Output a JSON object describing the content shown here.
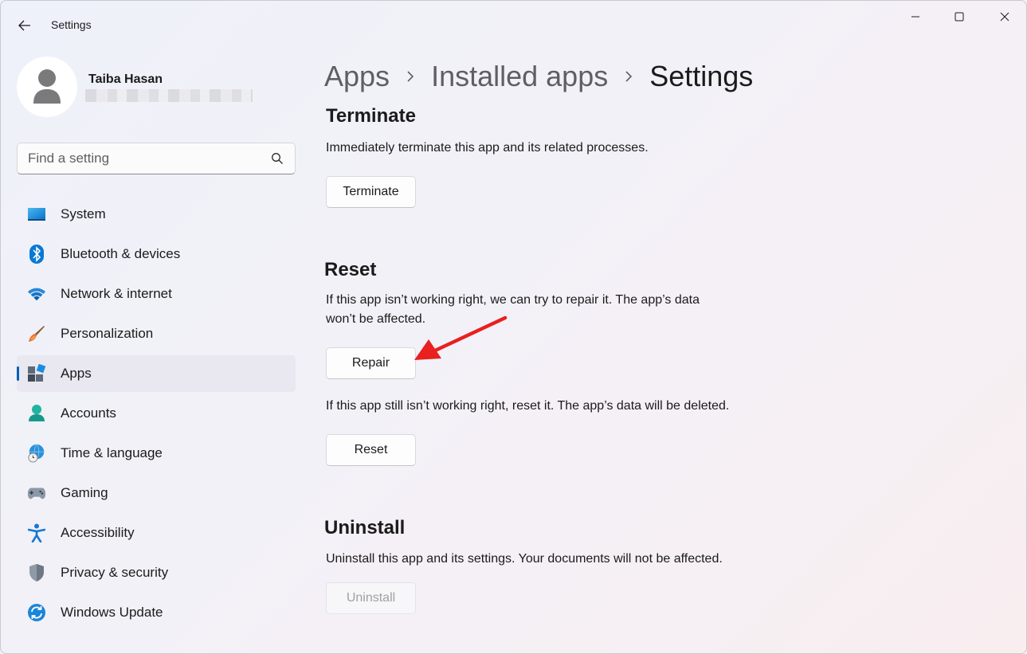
{
  "window": {
    "title": "Settings",
    "controls": {
      "minimize": "minimize-icon",
      "maximize": "maximize-icon",
      "close": "close-icon"
    }
  },
  "profile": {
    "name": "Taiba Hasan"
  },
  "search": {
    "placeholder": "Find a setting"
  },
  "nav": {
    "items": [
      {
        "label": "System",
        "icon": "system-icon"
      },
      {
        "label": "Bluetooth & devices",
        "icon": "bluetooth-icon"
      },
      {
        "label": "Network & internet",
        "icon": "wifi-icon"
      },
      {
        "label": "Personalization",
        "icon": "brush-icon"
      },
      {
        "label": "Apps",
        "icon": "apps-icon",
        "active": true
      },
      {
        "label": "Accounts",
        "icon": "accounts-icon"
      },
      {
        "label": "Time & language",
        "icon": "globe-clock-icon"
      },
      {
        "label": "Gaming",
        "icon": "gamepad-icon"
      },
      {
        "label": "Accessibility",
        "icon": "accessibility-icon"
      },
      {
        "label": "Privacy & security",
        "icon": "shield-icon"
      },
      {
        "label": "Windows Update",
        "icon": "update-icon"
      }
    ]
  },
  "breadcrumb": {
    "items": [
      "Apps",
      "Installed apps",
      "Settings"
    ]
  },
  "terminate": {
    "title": "Terminate",
    "description": "Immediately terminate this app and its related processes.",
    "button": "Terminate"
  },
  "reset": {
    "title": "Reset",
    "repair_description_line1": "If this app isn’t working right, we can try to repair it. The app’s data",
    "repair_description_line2": "won’t be affected.",
    "repair_button": "Repair",
    "reset_description": "If this app still isn’t working right, reset it. The app’s data will be deleted.",
    "reset_button": "Reset"
  },
  "uninstall": {
    "title": "Uninstall",
    "description": "Uninstall this app and its settings. Your documents will not be affected.",
    "button": "Uninstall",
    "button_disabled": true
  },
  "colors": {
    "accent": "#005fb8",
    "annotation_arrow": "#e8201f"
  }
}
